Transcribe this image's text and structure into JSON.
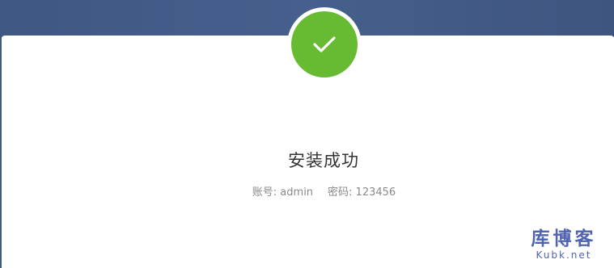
{
  "status": {
    "icon": "checkmark-icon",
    "title": "安装成功",
    "account_text": "账号: admin",
    "password_text": "密码: 123456",
    "success_color": "#66bb33"
  },
  "watermark": {
    "cn": "库博客",
    "en": "Kubk.net"
  },
  "colors": {
    "header": "#3f5783",
    "watermark": "#4f63b2"
  }
}
